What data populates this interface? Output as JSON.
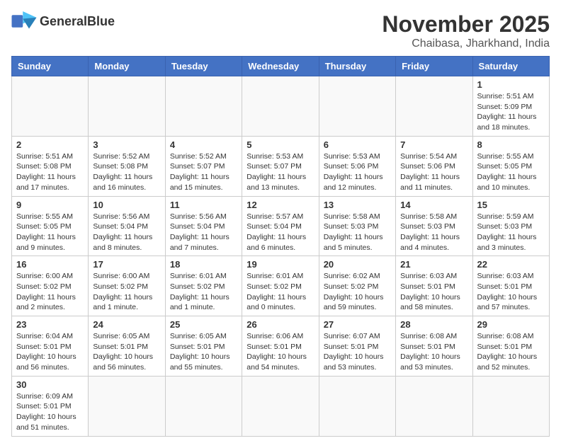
{
  "header": {
    "logo_text_normal": "General",
    "logo_text_bold": "Blue",
    "month_year": "November 2025",
    "location": "Chaibasa, Jharkhand, India"
  },
  "weekdays": [
    "Sunday",
    "Monday",
    "Tuesday",
    "Wednesday",
    "Thursday",
    "Friday",
    "Saturday"
  ],
  "days": [
    {
      "num": "",
      "info": ""
    },
    {
      "num": "",
      "info": ""
    },
    {
      "num": "",
      "info": ""
    },
    {
      "num": "",
      "info": ""
    },
    {
      "num": "",
      "info": ""
    },
    {
      "num": "",
      "info": ""
    },
    {
      "num": "1",
      "info": "Sunrise: 5:51 AM\nSunset: 5:09 PM\nDaylight: 11 hours\nand 18 minutes."
    },
    {
      "num": "2",
      "info": "Sunrise: 5:51 AM\nSunset: 5:08 PM\nDaylight: 11 hours\nand 17 minutes."
    },
    {
      "num": "3",
      "info": "Sunrise: 5:52 AM\nSunset: 5:08 PM\nDaylight: 11 hours\nand 16 minutes."
    },
    {
      "num": "4",
      "info": "Sunrise: 5:52 AM\nSunset: 5:07 PM\nDaylight: 11 hours\nand 15 minutes."
    },
    {
      "num": "5",
      "info": "Sunrise: 5:53 AM\nSunset: 5:07 PM\nDaylight: 11 hours\nand 13 minutes."
    },
    {
      "num": "6",
      "info": "Sunrise: 5:53 AM\nSunset: 5:06 PM\nDaylight: 11 hours\nand 12 minutes."
    },
    {
      "num": "7",
      "info": "Sunrise: 5:54 AM\nSunset: 5:06 PM\nDaylight: 11 hours\nand 11 minutes."
    },
    {
      "num": "8",
      "info": "Sunrise: 5:55 AM\nSunset: 5:05 PM\nDaylight: 11 hours\nand 10 minutes."
    },
    {
      "num": "9",
      "info": "Sunrise: 5:55 AM\nSunset: 5:05 PM\nDaylight: 11 hours\nand 9 minutes."
    },
    {
      "num": "10",
      "info": "Sunrise: 5:56 AM\nSunset: 5:04 PM\nDaylight: 11 hours\nand 8 minutes."
    },
    {
      "num": "11",
      "info": "Sunrise: 5:56 AM\nSunset: 5:04 PM\nDaylight: 11 hours\nand 7 minutes."
    },
    {
      "num": "12",
      "info": "Sunrise: 5:57 AM\nSunset: 5:04 PM\nDaylight: 11 hours\nand 6 minutes."
    },
    {
      "num": "13",
      "info": "Sunrise: 5:58 AM\nSunset: 5:03 PM\nDaylight: 11 hours\nand 5 minutes."
    },
    {
      "num": "14",
      "info": "Sunrise: 5:58 AM\nSunset: 5:03 PM\nDaylight: 11 hours\nand 4 minutes."
    },
    {
      "num": "15",
      "info": "Sunrise: 5:59 AM\nSunset: 5:03 PM\nDaylight: 11 hours\nand 3 minutes."
    },
    {
      "num": "16",
      "info": "Sunrise: 6:00 AM\nSunset: 5:02 PM\nDaylight: 11 hours\nand 2 minutes."
    },
    {
      "num": "17",
      "info": "Sunrise: 6:00 AM\nSunset: 5:02 PM\nDaylight: 11 hours\nand 1 minute."
    },
    {
      "num": "18",
      "info": "Sunrise: 6:01 AM\nSunset: 5:02 PM\nDaylight: 11 hours\nand 1 minute."
    },
    {
      "num": "19",
      "info": "Sunrise: 6:01 AM\nSunset: 5:02 PM\nDaylight: 11 hours\nand 0 minutes."
    },
    {
      "num": "20",
      "info": "Sunrise: 6:02 AM\nSunset: 5:02 PM\nDaylight: 10 hours\nand 59 minutes."
    },
    {
      "num": "21",
      "info": "Sunrise: 6:03 AM\nSunset: 5:01 PM\nDaylight: 10 hours\nand 58 minutes."
    },
    {
      "num": "22",
      "info": "Sunrise: 6:03 AM\nSunset: 5:01 PM\nDaylight: 10 hours\nand 57 minutes."
    },
    {
      "num": "23",
      "info": "Sunrise: 6:04 AM\nSunset: 5:01 PM\nDaylight: 10 hours\nand 56 minutes."
    },
    {
      "num": "24",
      "info": "Sunrise: 6:05 AM\nSunset: 5:01 PM\nDaylight: 10 hours\nand 56 minutes."
    },
    {
      "num": "25",
      "info": "Sunrise: 6:05 AM\nSunset: 5:01 PM\nDaylight: 10 hours\nand 55 minutes."
    },
    {
      "num": "26",
      "info": "Sunrise: 6:06 AM\nSunset: 5:01 PM\nDaylight: 10 hours\nand 54 minutes."
    },
    {
      "num": "27",
      "info": "Sunrise: 6:07 AM\nSunset: 5:01 PM\nDaylight: 10 hours\nand 53 minutes."
    },
    {
      "num": "28",
      "info": "Sunrise: 6:08 AM\nSunset: 5:01 PM\nDaylight: 10 hours\nand 53 minutes."
    },
    {
      "num": "29",
      "info": "Sunrise: 6:08 AM\nSunset: 5:01 PM\nDaylight: 10 hours\nand 52 minutes."
    },
    {
      "num": "30",
      "info": "Sunrise: 6:09 AM\nSunset: 5:01 PM\nDaylight: 10 hours\nand 51 minutes."
    },
    {
      "num": "",
      "info": ""
    },
    {
      "num": "",
      "info": ""
    },
    {
      "num": "",
      "info": ""
    },
    {
      "num": "",
      "info": ""
    },
    {
      "num": "",
      "info": ""
    },
    {
      "num": "",
      "info": ""
    }
  ]
}
